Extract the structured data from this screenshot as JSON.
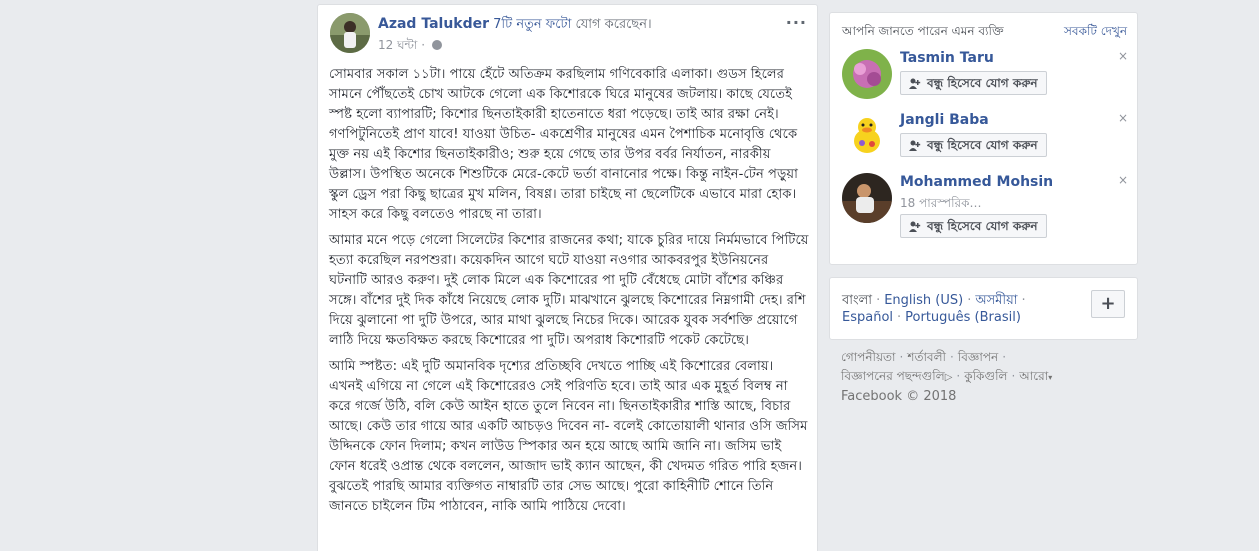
{
  "post": {
    "author": "Azad Talukder",
    "action_link": "7টি নতুন ফটো",
    "action_rest": "যোগ করেছেন।",
    "time": "12 ঘন্টা ·",
    "more": "···",
    "paragraphs": [
      "সোমবার সকাল ১১টা। পায়ে হেঁটে অতিক্রম করছিলাম গণিবেকারি এলাকা। গুডস হিলের সামনে পৌঁছতেই চোখ আটকে গেলো এক কিশোরকে ঘিরে মানুষের জটলায়। কাছে যেতেই স্পষ্ট হলো ব্যাপারটি; কিশোর ছিনতাইকারী হাতেনাতে ধরা পড়েছে। তাই আর রক্ষা নেই। গণপিটুনিতেই প্রাণ যাবে! যাওয়া উচিত- একশ্রেণীর মানুষের এমন পৈশাচিক মনোবৃত্তি থেকে মুক্ত নয় এই কিশোর ছিনতাইকারীও; শুরু হয়ে গেছে তার উপর বর্বর নির্যাতন, নারকীয় উল্লাস। উপস্থিত অনেকে শিশুটিকে মেরে-কেটে ভর্তা বানানোর পক্ষে। কিন্তু নাইন-টেন পড়ুয়া স্কুল ড্রেস পরা কিছু ছাত্রের মুখ মলিন, বিষণ্ণ। তারা চাইছে না ছেলেটিকে এভাবে মারা হোক। সাহস করে কিছু বলতেও পারছে না তারা।",
      "আমার মনে পড়ে গেলো সিলেটের কিশোর রাজনের কথা; যাকে চুরির দায়ে নির্মমভাবে পিটিয়ে হত্যা করেছিল নরপশুরা। কয়েকদিন আগে ঘটে যাওয়া নওগার আকবরপুর ইউনিয়নের ঘটনাটি আরও করুণ। দুই লোক মিলে এক কিশোরের পা দুটি বেঁধেছে মোটা বাঁশের কঞ্চির সঙ্গে। বাঁশের দুই দিক কাঁধে নিয়েছে লোক দুটি। মাঝখানে ঝুলছে কিশোরের নিম্নগামী দেহ। রশি দিয়ে ঝুলানো পা দুটি উপরে, আর মাথা ঝুলছে নিচের দিকে। আরেক যুবক সর্বশক্তি প্রয়োগে লাঠি দিয়ে ক্ষতবিক্ষত করছে কিশোরের পা দুটি। অপরাধ কিশোরটি পকেট কেটেছে।",
      "আমি স্পষ্টত: এই দুটি অমানবিক দৃশ্যের প্রতিচ্ছবি দেখতে পাচ্ছি এই কিশোরের বেলায়। এখনই এগিয়ে না গেলে এই কিশোরেরও সেই পরিণতি হবে। তাই আর এক মুহূর্ত বিলম্ব না করে গর্জে উঠি, বলি কেউ আইন হাতে তুলে নিবেন না। ছিনতাইকারীর শাস্তি আছে, বিচার আছে। কেউ তার গায়ে আর একটি আচড়ও দিবেন না- বলেই কোতোয়ালী থানার ওসি জসিম উদ্দিনকে ফোন দিলাম; কখন লাউড স্পিকার অন হয়ে আছে আমি জানি না। জসিম ভাই ফোন ধরেই ওপ্রান্ত থেকে বললেন, আজাদ ভাই ক্যান আছেন, কী খেদমত গরিত পারি হজন। বুঝতেই পারছি আমার ব্যক্তিগত নাম্বারটি তার সেভ আছে। পুরো কাহিনীটি শোনে তিনি জানতে চাইলেন টিম পাঠাবেন, নাকি আমি পাঠিয়ে দেবো।"
    ]
  },
  "pymk": {
    "title": "আপনি জানতে পারেন এমন ব্যক্তি",
    "see_all": "সবকটি দেখুন",
    "add_label": "বন্ধু হিসেবে যোগ করুন",
    "close": "×",
    "people": [
      {
        "name": "Tasmin Taru",
        "mutual": ""
      },
      {
        "name": "Jangli Baba",
        "mutual": ""
      },
      {
        "name": "Mohammed Mohsin",
        "mutual": "18 পারস্পরিক…"
      }
    ]
  },
  "languages": {
    "current": "বাংলা",
    "links": [
      "English (US)",
      "অসমীয়া",
      "Español",
      "Português (Brasil)"
    ],
    "sep": "·",
    "more": "+"
  },
  "footer": {
    "links": [
      "গোপনীয়তা",
      "শর্তাবলী",
      "বিজ্ঞাপন",
      "বিজ্ঞাপনের পছন্দগুলি",
      "কুকিগুলি",
      "আরো"
    ],
    "copyright": "Facebook © 2018"
  }
}
